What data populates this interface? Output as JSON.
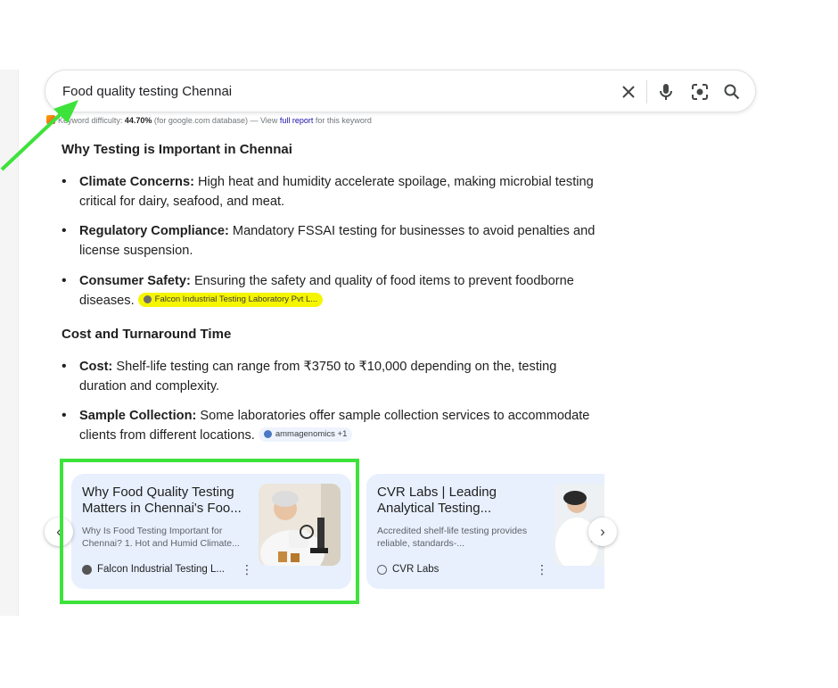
{
  "search": {
    "query": "Food quality testing Chennai",
    "clear_icon": "close-icon",
    "voice_icon": "microphone-icon",
    "lens_icon": "camera-lens-icon",
    "search_icon": "search-icon"
  },
  "keyword_difficulty": {
    "label": "Keyword difficulty: ",
    "value": "44.70%",
    "db_text": " (for google.com database) — View ",
    "link": "full report",
    "suffix": " for this keyword"
  },
  "sections": {
    "why_heading": "Why Testing is Important in Chennai",
    "why_items": [
      {
        "bold": "Climate Concerns:",
        "text": " High heat and humidity accelerate spoilage, making microbial testing critical for dairy, seafood, and meat."
      },
      {
        "bold": "Regulatory Compliance:",
        "text": " Mandatory FSSAI testing for businesses to avoid penalties and license suspension."
      },
      {
        "bold": "Consumer Safety:",
        "text": " Ensuring the safety and quality of food items to prevent foodborne diseases.",
        "chip": "Falcon Industrial Testing Laboratory Pvt L..."
      }
    ],
    "cost_heading": "Cost and Turnaround Time",
    "cost_items": [
      {
        "bold": "Cost:",
        "text": " Shelf-life testing can range from ₹3750 to ₹10,000 depending on the, testing duration and complexity."
      },
      {
        "bold": "Sample Collection:",
        "text": " Some laboratories offer sample collection services to accommodate clients from different locations.",
        "chip": "ammagenomics +1"
      }
    ]
  },
  "cards": [
    {
      "title": "Why Food Quality Testing Matters in Chennai's Foo...",
      "snippet": "Why Is Food Testing Important for Chennai? 1. Hot and Humid Climate...",
      "source": "Falcon Industrial Testing L...",
      "more": "⋮"
    },
    {
      "title": "CVR Labs | Leading Analytical Testing...",
      "snippet": "Accredited shelf-life testing provides reliable, standards-...",
      "source": "CVR Labs",
      "more": "⋮"
    }
  ],
  "carousel": {
    "prev": "‹",
    "next": "›"
  },
  "colors": {
    "annotation_green": "#3de23a",
    "chip_highlight": "#f6f500",
    "card_bg": "#e8f0fe"
  }
}
